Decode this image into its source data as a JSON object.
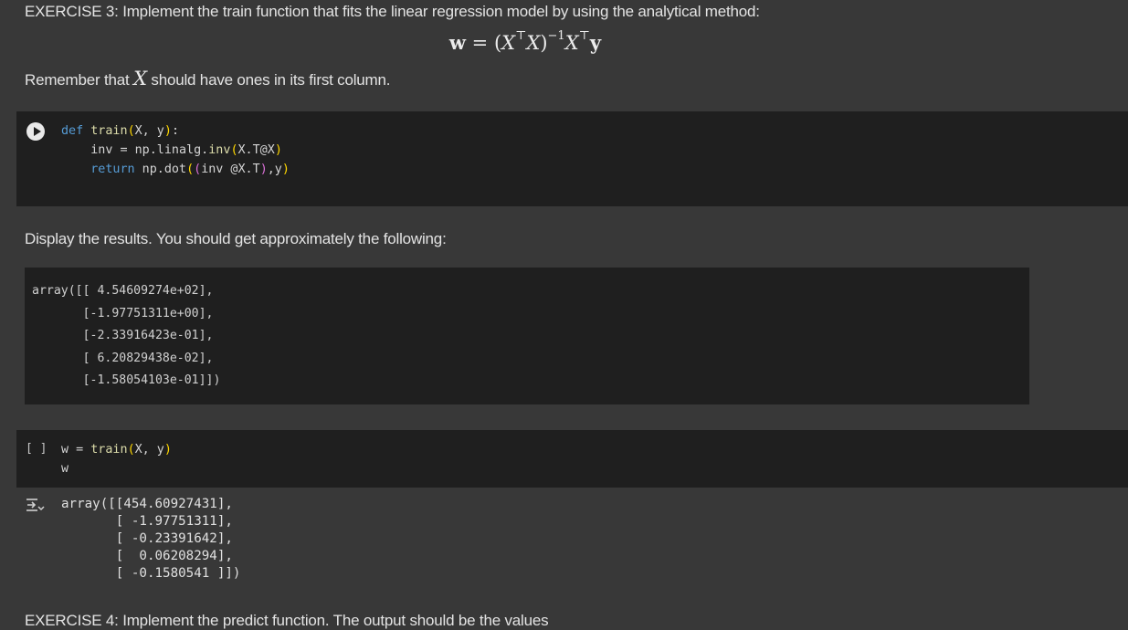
{
  "exercise3": {
    "heading": "EXERCISE 3: Implement the train function that fits the linear regression model by using the analytical method:",
    "formula": {
      "lhs": "w",
      "eq": "=",
      "open": "(",
      "X1": "X",
      "T1": "⊤",
      "X2": "X",
      "close": ")",
      "inv": "−1",
      "X3": "X",
      "T2": "⊤",
      "y": "y"
    },
    "remember_pre": "Remember that",
    "remember_var": "X",
    "remember_post": "should have ones in its first column."
  },
  "code_cell_1": {
    "run_button": "run",
    "line1_kw": "def",
    "line1_fn": "train",
    "line1_args": "X, y",
    "line2_lhs": "inv = np.linalg.",
    "line2_fn": "inv",
    "line2_arg": "X.T@X",
    "line3_kw": "return",
    "line3_mid": " np.dot",
    "line3_inner": "inv @X.T",
    "line3_tail": ",y"
  },
  "display_text": "Display the results. You should get approximately the following:",
  "expected_output": {
    "lines": [
      "array([[ 4.54609274e+02],",
      "       [-1.97751311e+00],",
      "       [-2.33916423e-01],",
      "       [ 6.20829438e-02],",
      "       [-1.58054103e-01]])"
    ]
  },
  "code_cell_2": {
    "execution_count": "[ ]",
    "line1_lhs": "w = ",
    "line1_fn": "train",
    "line1_args": "X, y",
    "line2": "w"
  },
  "cell_output": {
    "icon": "output-icon",
    "lines": [
      "array([[454.60927431],",
      "       [ -1.97751311],",
      "       [ -0.23391642],",
      "       [  0.06208294],",
      "       [ -0.1580541 ]])"
    ]
  },
  "next_text_cut": "EXERCISE 4: Implement the predict function. The output should be the values"
}
